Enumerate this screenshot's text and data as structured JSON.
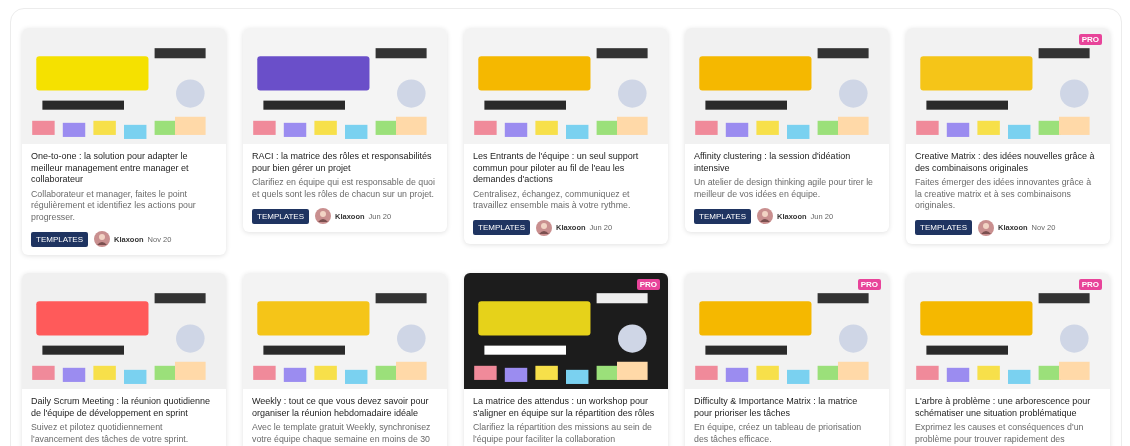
{
  "cards": [
    {
      "title": "One-to-one : la solution pour adapter le meilleur management entre manager et collaborateur",
      "description": "Collaborateur et manager, faites le point régulièrement et identifiez les actions pour progresser.",
      "tag": "TEMPLATES",
      "author": "Klaxoon",
      "date": "Nov 20"
    },
    {
      "title": "RACI : la matrice des rôles et responsabilités pour bien gérer un projet",
      "description": "Clarifiez en équipe qui est responsable de quoi et quels sont les rôles de chacun sur un projet.",
      "tag": "TEMPLATES",
      "author": "Klaxoon",
      "date": "Jun 20"
    },
    {
      "title": "Les Entrants de l'équipe : un seul support commun pour piloter au fil de l'eau les demandes d'actions",
      "description": "Centralisez, échangez, communiquez et travaillez ensemble mais à votre rythme.",
      "tag": "TEMPLATES",
      "author": "Klaxoon",
      "date": "Jun 20"
    },
    {
      "title": "Affinity clustering : la session d'idéation intensive",
      "description": "Un atelier de design thinking agile pour tirer le meilleur de vos idées en équipe.",
      "tag": "TEMPLATES",
      "author": "Klaxoon",
      "date": "Jun 20"
    },
    {
      "title": "Creative Matrix : des idées nouvelles grâce à des combinaisons originales",
      "description": "Faites émerger des idées innovantes grâce à la creative matrix et à ses combinaisons originales.",
      "tag": "TEMPLATES",
      "author": "Klaxoon",
      "date": "Nov 20",
      "badge": "PRO"
    },
    {
      "title": "Daily Scrum Meeting : la réunion quotidienne de l'équipe de développement en sprint",
      "description": "Suivez et pilotez quotidiennement l'avancement des tâches de votre sprint."
    },
    {
      "title": "Weekly : tout ce que vous devez savoir pour organiser la réunion hebdomadaire idéale",
      "description": "Avec le template gratuit Weekly, synchronisez votre équipe chaque semaine en moins de 30"
    },
    {
      "title": "La matrice des attendus : un workshop pour s'aligner en équipe sur la répartition des rôles",
      "description": "Clarifiez la répartition des missions au sein de l'équipe pour faciliter la collaboration",
      "badge": "PRO"
    },
    {
      "title": "Difficulty & Importance Matrix : la matrice pour prioriser les tâches",
      "description": "En équipe, créez un tableau de priorisation des tâches efficace.",
      "badge": "PRO"
    },
    {
      "title": "L'arbre à problème : une arborescence pour schématiser une situation problématique",
      "description": "Exprimez les causes et conséquences d'un problème pour trouver rapidement des",
      "badge": "PRO"
    }
  ]
}
